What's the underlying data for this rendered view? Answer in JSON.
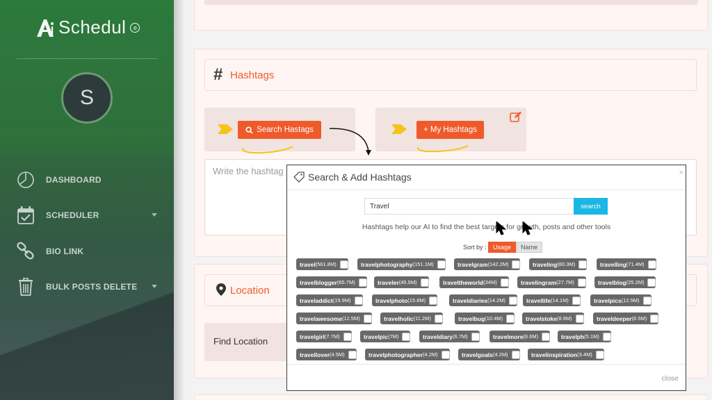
{
  "sidebar": {
    "logo_text": "Schedul",
    "logo_mark": "A",
    "avatar_letter": "S",
    "items": [
      {
        "label": "DASHBOARD",
        "icon": "clock-pie-icon",
        "has_caret": false
      },
      {
        "label": "SCHEDULER",
        "icon": "calendar-check-icon",
        "has_caret": true
      },
      {
        "label": "BIO LINK",
        "icon": "link-chain-icon",
        "has_caret": false
      },
      {
        "label": "BULK POSTS DELETE",
        "icon": "trash-icon",
        "has_caret": true
      }
    ]
  },
  "hashtags_section": {
    "symbol": "#",
    "title": "Hashtags",
    "search_button": "Search Hastags",
    "my_hashtags_button": "+ My Hashtags",
    "textarea_placeholder": "Write the hashtag"
  },
  "location_section": {
    "title": "Location",
    "find_label": "Find Location"
  },
  "modal": {
    "title": "Search & Add Hashtags",
    "close_x": "×",
    "search_value": "Travel",
    "search_button": "search",
    "help_text": "Hashtags help our AI to find the best targets for growth, posts and other tools",
    "sort_label": "Sort by :",
    "sort_usage": "Usage",
    "sort_name": "Name",
    "close_link": "close",
    "rows": [
      [
        {
          "name": "travel",
          "count": "(561.8M)"
        },
        {
          "name": "travelphotography",
          "count": "(151.1M)"
        },
        {
          "name": "travelgram",
          "count": "(142.2M)"
        },
        {
          "name": "traveling",
          "count": "(80.3M)"
        },
        {
          "name": "travelling",
          "count": "(71.4M)"
        }
      ],
      [
        {
          "name": "travelblogger",
          "count": "(65.7M)"
        },
        {
          "name": "traveler",
          "count": "(45.5M)"
        },
        {
          "name": "traveltheworld",
          "count": "(34M)"
        },
        {
          "name": "travelingram",
          "count": "(27.7M)"
        },
        {
          "name": "travelblog",
          "count": "(25.2M)"
        }
      ],
      [
        {
          "name": "traveladdict",
          "count": "(19.9M)"
        },
        {
          "name": "travelphoto",
          "count": "(15.8M)"
        },
        {
          "name": "traveldiaries",
          "count": "(14.2M)"
        },
        {
          "name": "travellife",
          "count": "(14.1M)"
        },
        {
          "name": "travelpics",
          "count": "(12.5M)"
        }
      ],
      [
        {
          "name": "travelawesome",
          "count": "(12.5M)"
        },
        {
          "name": "travelholic",
          "count": "(11.2M)"
        },
        {
          "name": "travelbug",
          "count": "(10.4M)"
        },
        {
          "name": "travelstoke",
          "count": "(8.9M)"
        },
        {
          "name": "traveldeeper",
          "count": "(8.5M)"
        }
      ],
      [
        {
          "name": "travelgirl",
          "count": "(7.7M)"
        },
        {
          "name": "travelpic",
          "count": "(7M)"
        },
        {
          "name": "traveldiary",
          "count": "(6.7M)"
        },
        {
          "name": "travelmore",
          "count": "(6.6M)"
        },
        {
          "name": "travelph",
          "count": "(5.1M)"
        }
      ],
      [
        {
          "name": "travellover",
          "count": "(4.5M)"
        },
        {
          "name": "travelphotographer",
          "count": "(4.2M)"
        },
        {
          "name": "travelgoals",
          "count": "(4.2M)"
        },
        {
          "name": "travelinspiration",
          "count": "(3.4M)"
        }
      ]
    ]
  },
  "colors": {
    "accent": "#ef5a2a",
    "search_blue": "#1ab6e4",
    "tag_gray": "#686868",
    "yellow": "#f6c21c"
  }
}
